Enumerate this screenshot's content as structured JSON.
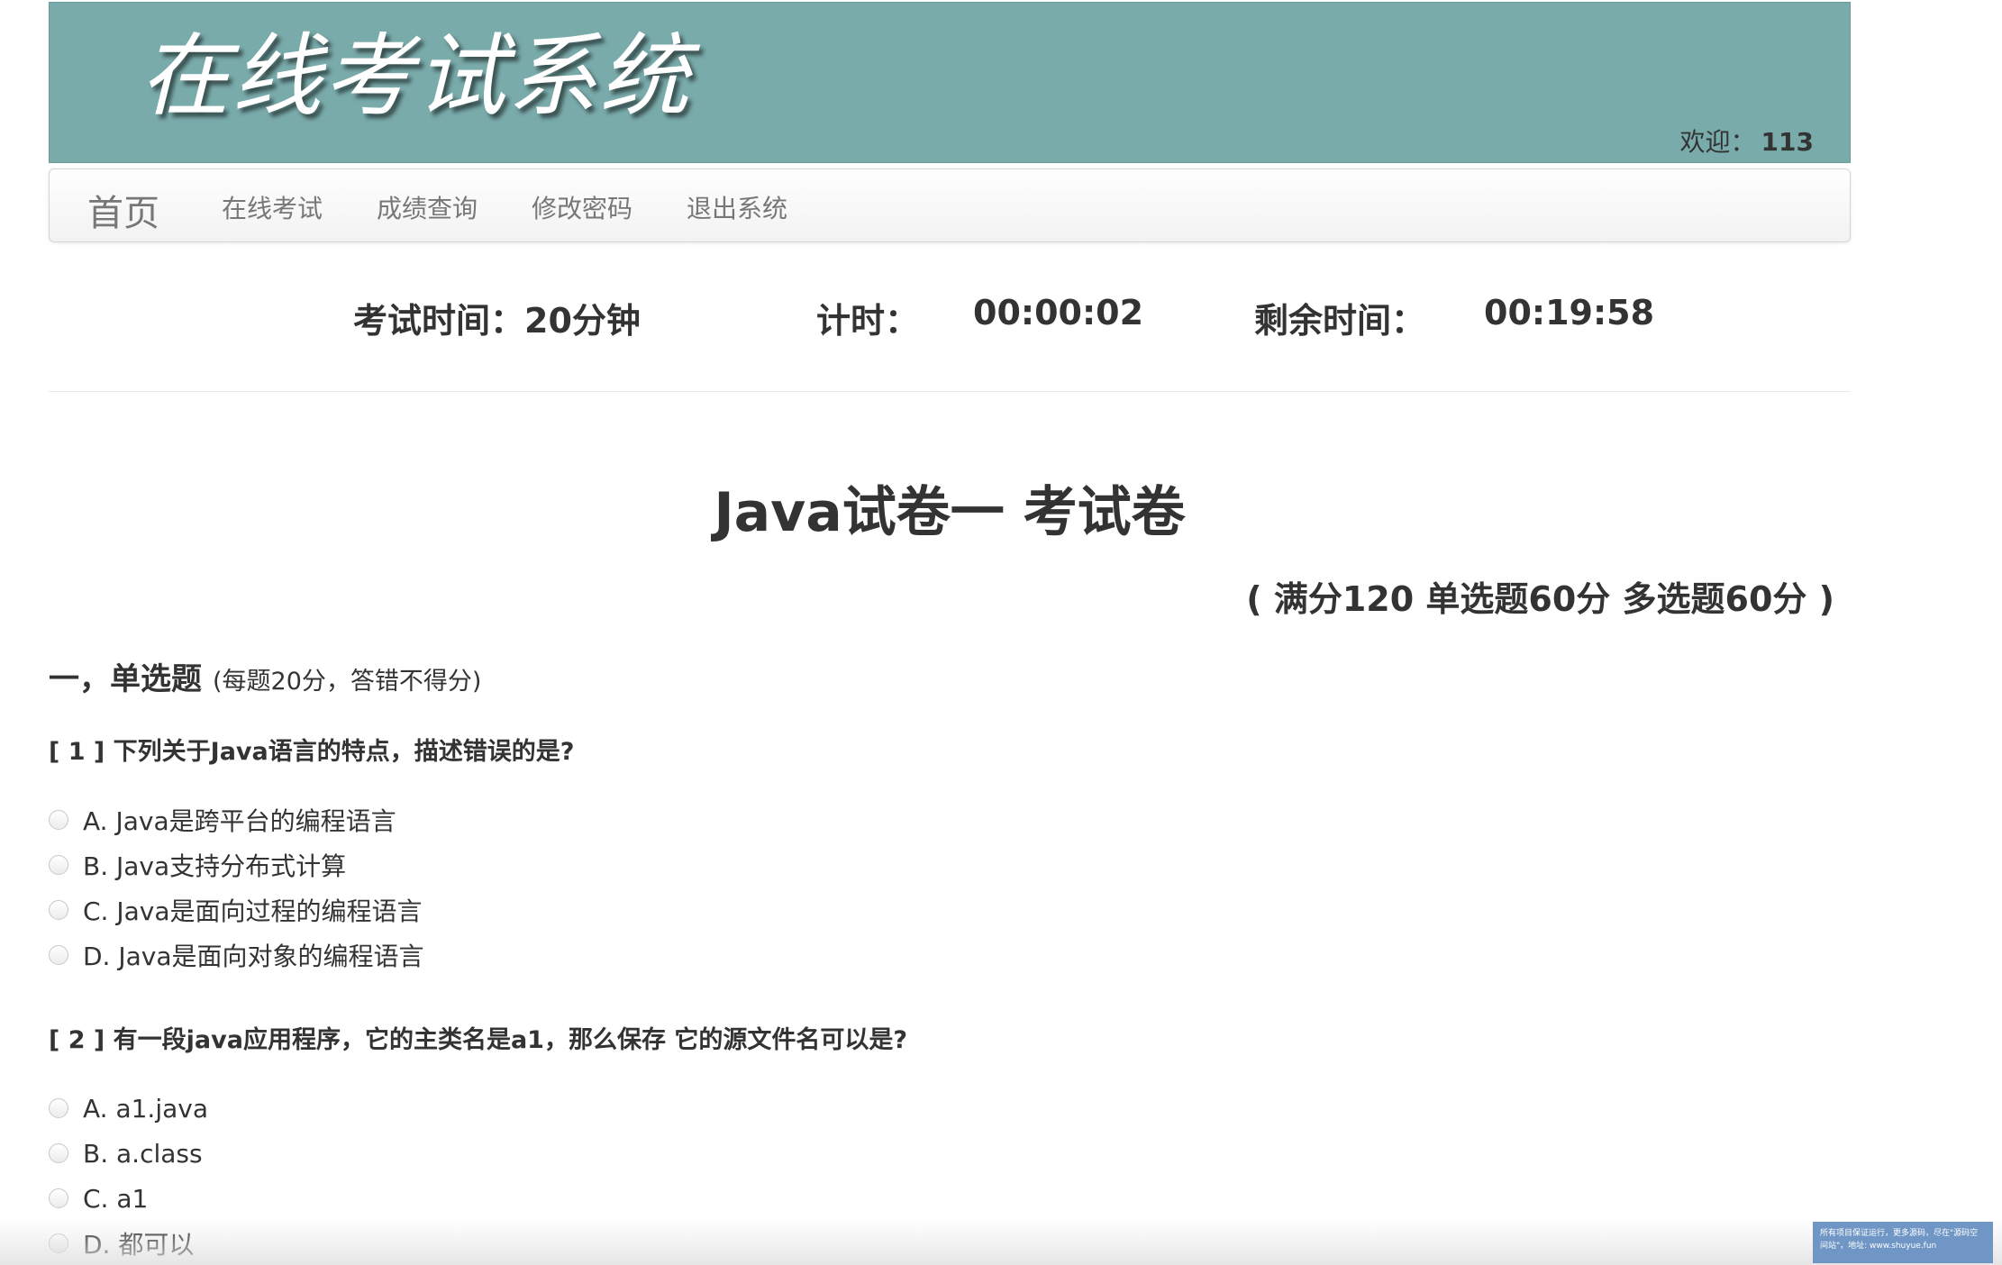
{
  "header": {
    "title": "在线考试系统",
    "welcome_label": "欢迎：",
    "username": "113"
  },
  "nav": {
    "brand": "首页",
    "items": [
      "在线考试",
      "成绩查询",
      "修改密码",
      "退出系统"
    ]
  },
  "timer": {
    "exam_time_label": "考试时间：",
    "exam_time_value": "20分钟",
    "elapsed_label": "计时：",
    "elapsed_value": "00:00:02",
    "remaining_label": "剩余时间：",
    "remaining_value": "00:19:58"
  },
  "paper": {
    "title": "Java试卷一  考试卷",
    "score_info": "( 满分120  单选题60分  多选题60分 )"
  },
  "section": {
    "title": "一，单选题",
    "note": "(每题20分，答错不得分)"
  },
  "questions": [
    {
      "text": "[ 1 ] 下列关于Java语言的特点，描述错误的是?",
      "options": [
        "A. Java是跨平台的编程语言",
        "B. Java支持分布式计算",
        "C. Java是面向过程的编程语言",
        "D. Java是面向对象的编程语言"
      ]
    },
    {
      "text": "[ 2 ] 有一段java应用程序，它的主类名是a1，那么保存 它的源文件名可以是?",
      "options": [
        "A. a1.java",
        "B. a.class",
        "C. a1",
        "D. 都可以"
      ]
    }
  ],
  "watermark": {
    "text": "所有项目保证运行，更多源码，尽在\"源码空间站\"，地址: www.shuyue.fun"
  },
  "colors": {
    "banner_bg": "#7aabab",
    "text": "#333333",
    "nav_text": "#777777",
    "watermark_bg": "#6f96c4"
  }
}
